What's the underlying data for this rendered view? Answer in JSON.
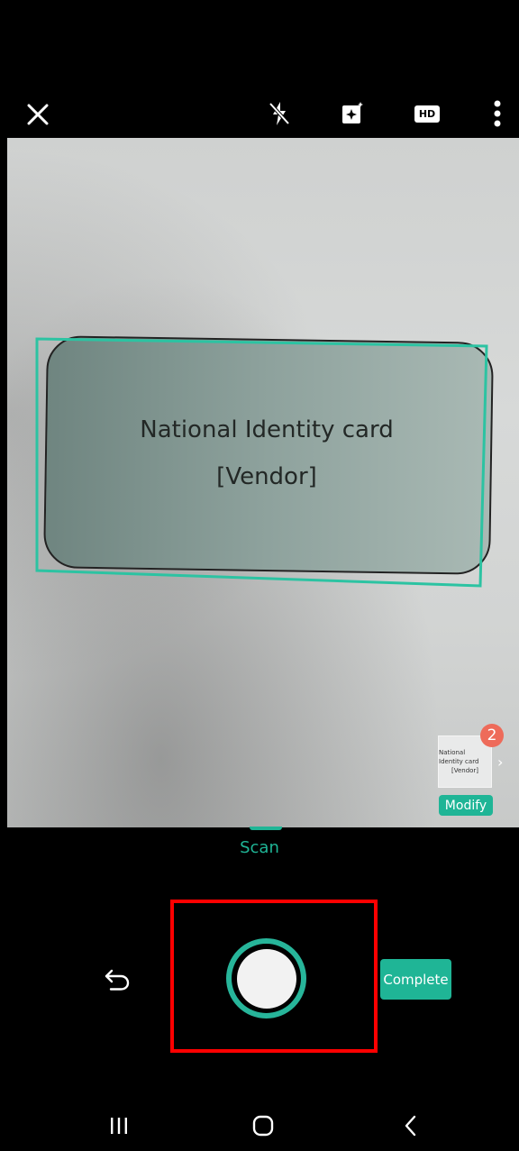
{
  "top_bar": {
    "close_icon": "close-icon",
    "flash_icon": "flash-off-icon",
    "enhance_icon": "enhance-icon",
    "hd_label": "HD",
    "more_icon": "more-vertical-icon"
  },
  "preview": {
    "card_text_line1": "National Identity card",
    "card_text_line2": "[Vendor]",
    "outline_color": "#2cc3a2"
  },
  "thumbnail": {
    "count": "2",
    "text_line1": "National Identity card",
    "text_line2": "[Vendor]",
    "modify_label": "Modify"
  },
  "mode": {
    "label": "Scan"
  },
  "controls": {
    "undo_icon": "undo-icon",
    "shutter_icon": "shutter-icon",
    "complete_label": "Complete"
  },
  "nav_bar": {
    "recents_icon": "recents-icon",
    "home_icon": "home-icon",
    "back_icon": "back-icon"
  },
  "colors": {
    "accent": "#1fb596",
    "highlight_box": "#ff0000",
    "badge": "#ee6b5a",
    "background": "#000000"
  }
}
